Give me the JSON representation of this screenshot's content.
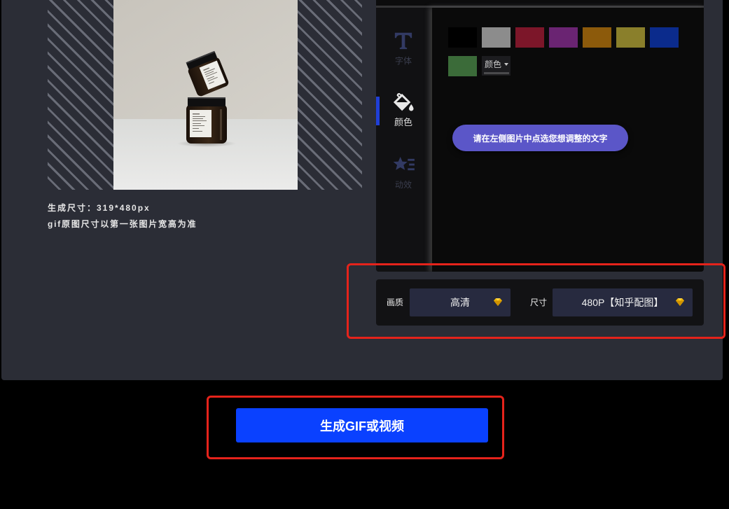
{
  "theme": {
    "page_bg": "#000000",
    "panel_bg": "#2b2d36",
    "accent_blue": "#0a41ff",
    "hint_purple": "#5b56c8",
    "active_indicator": "#1f3fd6",
    "premium_gold": "#f2b705",
    "annotation_red": "#e5231b"
  },
  "preview": {
    "size_text": "生成尺寸：319*480px",
    "note_text": "gif原图尺寸以第一张图片宽高为准"
  },
  "sidebar": {
    "items": [
      {
        "label": "字体",
        "icon": "text-icon",
        "active": false
      },
      {
        "label": "颜色",
        "icon": "paint-bucket-icon",
        "active": true
      },
      {
        "label": "动效",
        "icon": "star-list-icon",
        "active": false
      }
    ]
  },
  "palette": {
    "colors": [
      "#000000",
      "#8c8c8c",
      "#7c1629",
      "#6a2472",
      "#8c5a0b",
      "#8a7f2b",
      "#0b2b8c",
      "#3b6b39"
    ],
    "dropdown_label": "颜色"
  },
  "hint": {
    "text": "请在左侧图片中点选您想调整的文字"
  },
  "settings": {
    "quality_label": "画质",
    "quality_value": "高清",
    "quality_icon": "diamond-icon",
    "size_label": "尺寸",
    "size_value": "480P【知乎配图】",
    "size_icon": "diamond-icon"
  },
  "generate": {
    "label": "生成GIF或视频"
  }
}
